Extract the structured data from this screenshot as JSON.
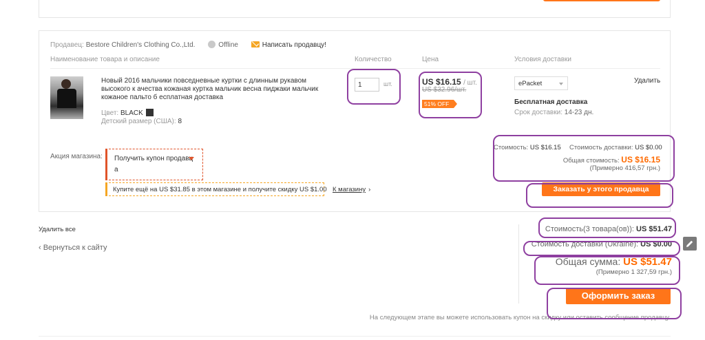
{
  "seller": {
    "label": "Продавец:",
    "name": "Bestore Children's Clothing Co.,Ltd.",
    "status": "Offline",
    "message_link": "Написать продавцу!"
  },
  "columns": {
    "product": "Наименование товара и описание",
    "quantity": "Количество",
    "price": "Цена",
    "shipping": "Условия доставки"
  },
  "product": {
    "title": "Новый 2016 мальчики повседневные куртки с длинным рукавом высокого к ачества кожаная куртка мальчик весна пиджаки мальчик кожаное пальто б есплатная доставка",
    "color_label": "Цвет:",
    "color_value": "BLACK",
    "size_label": "Детский размер (США):",
    "size_value": "8",
    "quantity": "1",
    "quantity_unit": "шт.",
    "price": "US $16.15",
    "price_unit": "/ шт.",
    "old_price": "US $32.96/шт.",
    "discount": "51% OFF",
    "shipping_method": "ePacket",
    "free_shipping": "Бесплатная доставка",
    "delivery_label": "Срок доставки:",
    "delivery_value": "14-23 дн.",
    "delete": "Удалить"
  },
  "store_promo": {
    "label": "Акция магазина:",
    "coupon_line1": "Получить купон продавц",
    "coupon_line2": "а",
    "promo_text": "Купите ещё на US $31.85 в этом магазине и получите скидку US $1.00",
    "shop_link": "К магазину",
    "shop_link_arrow": "›"
  },
  "seller_summary": {
    "cost_label": "Стоимость:",
    "cost_value": "US $16.15",
    "ship_label": "Стоимость доставки:",
    "ship_value": "US $0.00",
    "total_label": "Общая стоимость:",
    "total_value": "US $16.15",
    "approx": "(Примерно 416,57 грн.)",
    "order_button": "Заказать у этого продавца"
  },
  "cart": {
    "delete_all": "Удалить все",
    "back_link": "‹ Вернуться к сайту",
    "cost_label": "Стоимость(3 товара(ов)):",
    "cost_value": "US $51.47",
    "ship_label": "Стоимость доставки (Ukraine):",
    "ship_value": "US $0.00",
    "grand_label": "Общая сумма:",
    "grand_value": "US $51.47",
    "grand_approx": "(Примерно 1 327,59 грн.)",
    "checkout_button": "Оформить заказ",
    "next_note": "На следующем этапе вы можете использовать купон на скидку или оставить сообщение продавцу."
  },
  "colors": {
    "accent": "#ff7519",
    "price_highlight": "#ff6a00",
    "annotation": "#8e3fa0"
  },
  "icons": [
    "status-dot-icon",
    "mail-icon",
    "color-swatch-icon",
    "caret-down-icon",
    "pencil-icon"
  ]
}
